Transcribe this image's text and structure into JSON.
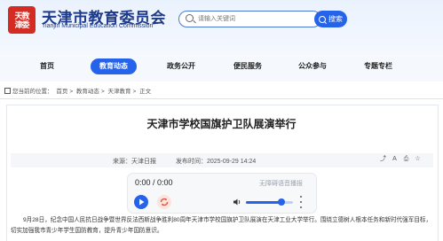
{
  "header": {
    "logo_text_line1": "天教",
    "logo_text_line2": "津委",
    "site_title": "天津市教育委员会",
    "site_subtitle": "Tianjin Municipal Education Commission",
    "search_placeholder": "请输入关键词",
    "search_button": "搜索"
  },
  "nav": {
    "items": [
      "首页",
      "教育动态",
      "政务公开",
      "便民服务",
      "公众参与",
      "专题专栏"
    ],
    "active_index": 1
  },
  "breadcrumb": {
    "prefix": "您当前的位置：",
    "items": [
      "首页",
      "教育动态",
      "天津教育",
      "正文"
    ],
    "separator": ">"
  },
  "article": {
    "title": "天津市学校国旗护卫队展演举行",
    "source_label": "来源：",
    "source": "天津日报",
    "time_label": "发布时间：",
    "time": "2025-09-29 14:24",
    "body": "9月28日，纪念中国人民抗日战争暨世界反法西斯战争胜利80周年天津市学校国旗护卫队展演在天津工业大学举行。围绕立德树人根本任务和新时代强军目标，切实加强我市青少年学生国防教育，提升青少年国防意识。"
  },
  "player": {
    "time": "0:00 / 0:00",
    "accessible_label": "无障碍语音播报",
    "volume_level": 0.75
  },
  "colors": {
    "brand_blue": "#2563eb",
    "title_navy": "#1e3a8a",
    "logo_red": "#d42b22"
  }
}
